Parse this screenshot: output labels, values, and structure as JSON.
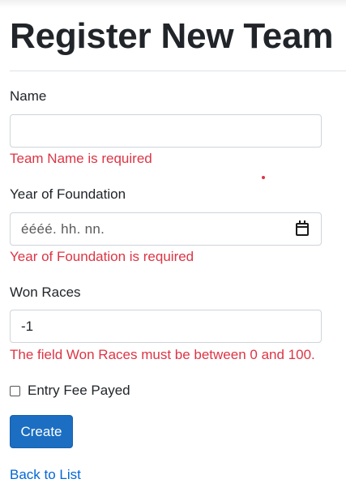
{
  "page_title": "Register New Team",
  "fields": {
    "name": {
      "label": "Name",
      "value": "",
      "error": "Team Name is required"
    },
    "year": {
      "label": "Year of Foundation",
      "placeholder": "éééé. hh. nn.",
      "error": "Year of Foundation is required"
    },
    "won_races": {
      "label": "Won Races",
      "value": "-1",
      "error": "The field Won Races must be between 0 and 100."
    }
  },
  "entry_fee": {
    "label": "Entry Fee Payed",
    "checked": false
  },
  "create_button": "Create",
  "back_link": "Back to List",
  "colors": {
    "error": "#dc3545",
    "primary": "#1b6ec2",
    "link": "#0366d6"
  }
}
